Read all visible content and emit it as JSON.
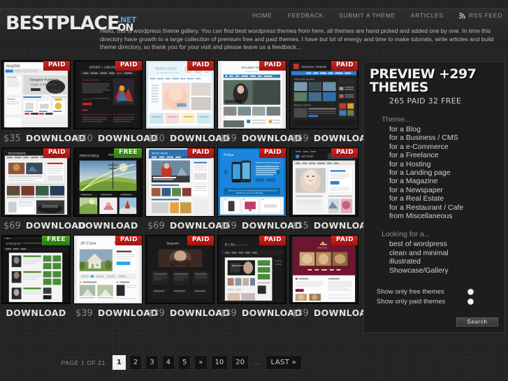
{
  "site": {
    "logo_main": "BESTPLACE",
    "logo_net": ".NET",
    "logo_on": "ON"
  },
  "nav": {
    "items": [
      {
        "label": "HOME",
        "icon": ""
      },
      {
        "label": "FEEDBACK",
        "icon": ""
      },
      {
        "label": "SUBMIT A THEME",
        "icon": ""
      },
      {
        "label": "ARTICLES",
        "icon": ""
      },
      {
        "label": "RSS FEED",
        "icon": "rss-icon"
      }
    ]
  },
  "intro": {
    "text": "Hello, this is wordpress theme gallery. You can find best wordpress themes from here, all themes are hand picked and added one by one. In time this directory have growth to a large collection of premium free and paid themes. I have but lot of energy and time to make tutorials, write articles and build theme directory, so thank you for your visit and please leave us a feedback..."
  },
  "colors": {
    "paid_badge": "#bb1a16",
    "free_badge": "#3d8f19",
    "accent_blue": "#5b9bd5",
    "page_bg": "#242424",
    "sidebar_bg": "#1d1d1d"
  },
  "themes": [
    {
      "name": "Majine",
      "badge": "PAID",
      "price": "$35",
      "download": "DOWNLOAD",
      "style": "majine"
    },
    {
      "name": "Sport Grunge",
      "badge": "PAID",
      "price": "$40",
      "download": "DOWNLOAD",
      "style": "sport"
    },
    {
      "name": "Baby Shop",
      "badge": "PAID",
      "price": "$40",
      "download": "DOWNLOAD",
      "style": "baby"
    },
    {
      "name": "Polaris Theme",
      "badge": "PAID",
      "price": "$69",
      "download": "DOWNLOAD",
      "style": "polaris"
    },
    {
      "name": "Graphic Theme",
      "badge": "PAID",
      "price": "$69",
      "download": "DOWNLOAD",
      "style": "graphic"
    },
    {
      "name": "Telegraph",
      "badge": "PAID",
      "price": "$69",
      "download": "DOWNLOAD",
      "style": "telegraph"
    },
    {
      "name": "Photoria",
      "badge": "FREE",
      "price": "",
      "download": "DOWNLOAD",
      "style": "photoria"
    },
    {
      "name": "Sport News",
      "badge": "PAID",
      "price": "$69",
      "download": "DOWNLOAD",
      "style": "sportnews"
    },
    {
      "name": "Prima",
      "badge": "PAID",
      "price": "$69",
      "download": "DOWNLOAD",
      "style": "prima"
    },
    {
      "name": "Art Shop",
      "badge": "PAID",
      "price": "$35",
      "download": "DOWNLOAD",
      "style": "artshop"
    },
    {
      "name": "Earthing Bar",
      "badge": "FREE",
      "price": "",
      "download": "DOWNLOAD",
      "style": "earth"
    },
    {
      "name": "di Casa",
      "badge": "PAID",
      "price": "$39",
      "download": "DOWNLOAD",
      "style": "dicasa"
    },
    {
      "name": "Degusto",
      "badge": "PAID",
      "price": "$39",
      "download": "DOWNLOAD",
      "style": "degusto"
    },
    {
      "name": "B | M",
      "badge": "PAID",
      "price": "$39",
      "download": "DOWNLOAD",
      "style": "bm"
    },
    {
      "name": "Wine Cafe",
      "badge": "PAID",
      "price": "$39",
      "download": "DOWNLOAD",
      "style": "wine"
    }
  ],
  "sidebar": {
    "title_line1": "PREVIEW",
    "title_count": "+297",
    "title_line2": "THEMES",
    "counts": "265 PAID  32 FREE",
    "theme_group_label": "Theme...",
    "theme_links": [
      "for a Blog",
      "for a Business / CMS",
      "for a e-Commerce",
      "for a Freelance",
      "for a Hosting",
      "for a Landing page",
      "for a Magazine",
      "for a Newspaper",
      "for a Real Estate",
      "for a Restaurant / Cafe",
      "from Miscellaneous"
    ],
    "looking_group_label": "Looking for a...",
    "looking_links": [
      "best of wordpress",
      "clean and minimal",
      "illustrated",
      "Showcase/Gallery"
    ],
    "filters": [
      {
        "label": "Show only free themes",
        "checked": false
      },
      {
        "label": "Show only paid themes",
        "checked": false
      }
    ],
    "search_label": "Search"
  },
  "pagination": {
    "label": "PAGE 1 OF 21",
    "current_page": "1",
    "pages": [
      "1",
      "2",
      "3",
      "4",
      "5",
      "»",
      "10",
      "20"
    ],
    "dots": "...",
    "last_label": "LAST »"
  }
}
